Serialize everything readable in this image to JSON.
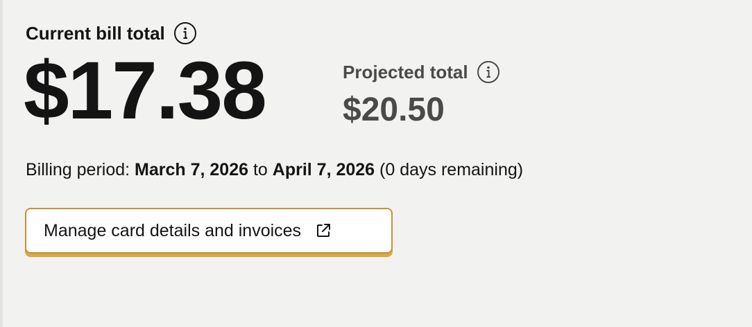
{
  "current_bill": {
    "label": "Current bill total",
    "amount": "$17.38",
    "info_icon": "info-icon"
  },
  "projected": {
    "label": "Projected total",
    "amount": "$20.50",
    "info_icon": "info-icon"
  },
  "billing_period": {
    "prefix": "Billing period: ",
    "start": "March 7, 2026",
    "connector": " to ",
    "end": "April 7, 2026",
    "remaining": " (0 days remaining)"
  },
  "manage_button": {
    "label": "Manage card details and invoices",
    "icon": "external-link-icon"
  },
  "colors": {
    "background": "#f2f2f0",
    "primary_text": "#141414",
    "secondary_text": "#4a4a4a",
    "button_border": "#c7922f",
    "button_shadow": "#d9a64a"
  }
}
